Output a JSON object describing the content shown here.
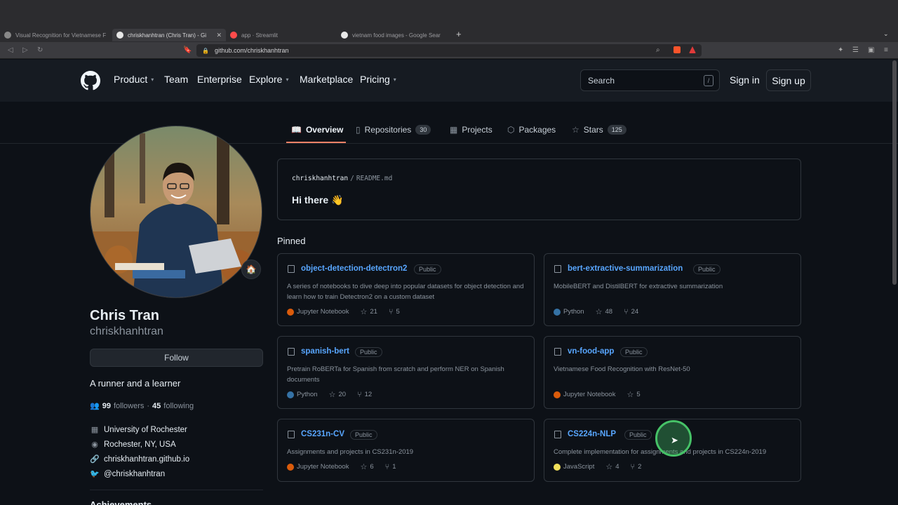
{
  "browser": {
    "tabs": [
      {
        "title": "Visual Recognition for Vietnamese F",
        "active": false
      },
      {
        "title": "chriskhanhtran (Chris Tran) - Gi",
        "active": true
      },
      {
        "title": "app · Streamlit",
        "active": false
      },
      {
        "title": "vietnam food images - Google Sear",
        "active": false
      }
    ],
    "url": "github.com/chriskhanhtran"
  },
  "header": {
    "nav": [
      {
        "label": "Product",
        "dropdown": true
      },
      {
        "label": "Team",
        "dropdown": false
      },
      {
        "label": "Enterprise",
        "dropdown": false
      },
      {
        "label": "Explore",
        "dropdown": true
      },
      {
        "label": "Marketplace",
        "dropdown": false
      },
      {
        "label": "Pricing",
        "dropdown": true
      }
    ],
    "search_placeholder": "Search",
    "search_shortcut": "/",
    "sign_in": "Sign in",
    "sign_up": "Sign up"
  },
  "profile_tabs": [
    {
      "label": "Overview",
      "icon": "book-icon",
      "count": ""
    },
    {
      "label": "Repositories",
      "icon": "repo-icon",
      "count": "30"
    },
    {
      "label": "Projects",
      "icon": "table-icon",
      "count": ""
    },
    {
      "label": "Packages",
      "icon": "package-icon",
      "count": ""
    },
    {
      "label": "Stars",
      "icon": "star-icon",
      "count": "125"
    }
  ],
  "profile": {
    "name": "Chris Tran",
    "username": "chriskhanhtran",
    "follow_label": "Follow",
    "bio": "A runner and a learner",
    "followers": "99",
    "followers_label": "followers",
    "following": "45",
    "following_label": "following",
    "separator": "·",
    "organization": "University of Rochester",
    "location": "Rochester, NY, USA",
    "website": "chriskhanhtran.github.io",
    "twitter": "@chriskhanhtran",
    "achievements_label": "Achievements"
  },
  "readme": {
    "owner": "chriskhanhtran",
    "separator": "/",
    "file": "README.md",
    "greeting": "Hi there 👋"
  },
  "pinned": {
    "title": "Pinned",
    "repos": [
      {
        "name": "object-detection-detectron2",
        "visibility": "Public",
        "description": "A series of notebooks to dive deep into popular datasets for object detection and learn how to train Detectron2 on a custom dataset",
        "language": "Jupyter Notebook",
        "lang_color": "#DA5B0B",
        "stars": "21",
        "forks": "5"
      },
      {
        "name": "bert-extractive-summarization",
        "visibility": "Public",
        "description": "MobileBERT and DistilBERT for extractive summarization",
        "language": "Python",
        "lang_color": "#3572A5",
        "stars": "48",
        "forks": "24"
      },
      {
        "name": "spanish-bert",
        "visibility": "Public",
        "description": "Pretrain RoBERTa for Spanish from scratch and perform NER on Spanish documents",
        "language": "Python",
        "lang_color": "#3572A5",
        "stars": "20",
        "forks": "12"
      },
      {
        "name": "vn-food-app",
        "visibility": "Public",
        "description": "Vietnamese Food Recognition with ResNet-50",
        "language": "Jupyter Notebook",
        "lang_color": "#DA5B0B",
        "stars": "5",
        "forks": ""
      },
      {
        "name": "CS231n-CV",
        "visibility": "Public",
        "description": "Assignments and projects in CS231n-2019",
        "language": "Jupyter Notebook",
        "lang_color": "#DA5B0B",
        "stars": "6",
        "forks": "1"
      },
      {
        "name": "CS224n-NLP",
        "visibility": "Public",
        "description": "Complete implementation for assignments and projects in CS224n-2019",
        "language": "JavaScript",
        "lang_color": "#F1E05A",
        "stars": "4",
        "forks": "2"
      }
    ]
  }
}
